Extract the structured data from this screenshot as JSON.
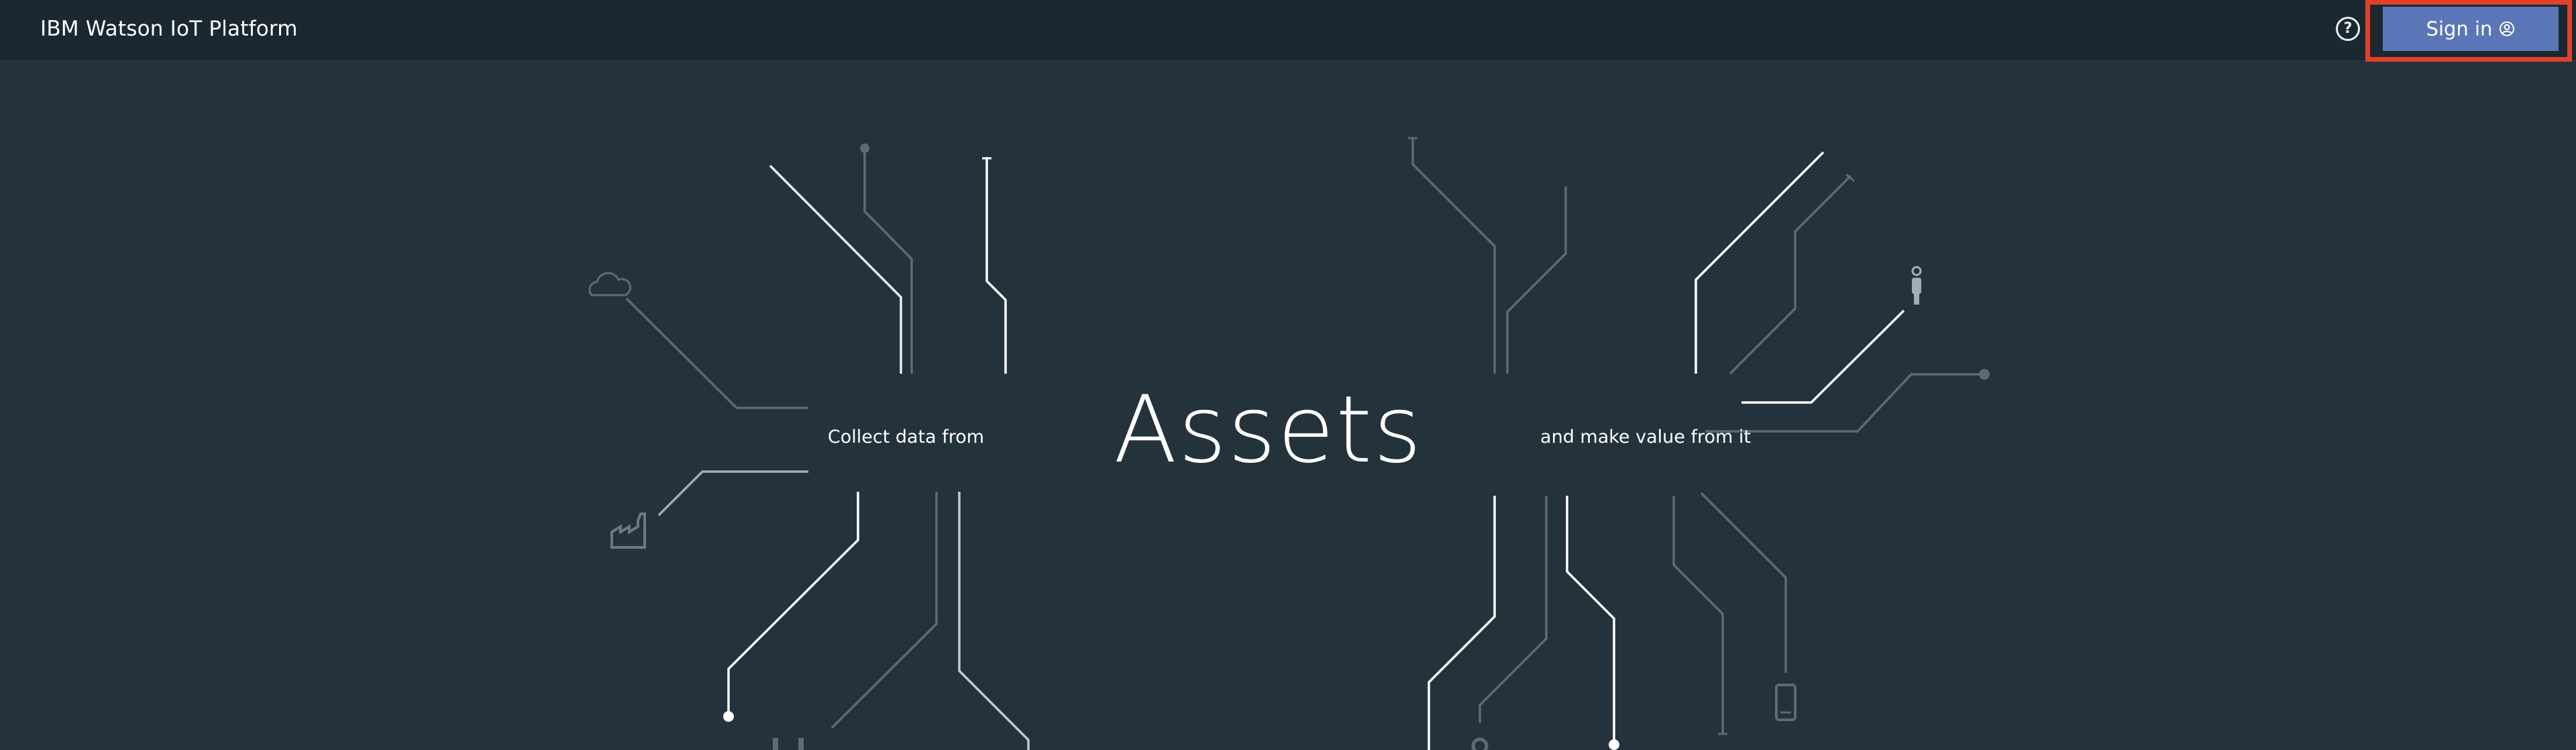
{
  "header": {
    "app_title": "IBM Watson IoT Platform",
    "help_label": "?",
    "signin_label": "Sign in"
  },
  "hero": {
    "left_caption": "Collect data from",
    "title": "Assets",
    "right_caption": "and make value from it"
  },
  "icons": {
    "help": "question-circle-icon",
    "user": "user-circle-icon",
    "cloud": "cloud-icon",
    "factory": "factory-icon",
    "person": "person-icon",
    "mobile": "mobile-phone-icon",
    "gear": "gear-icon",
    "plug": "plug-icon"
  },
  "colors": {
    "background": "#24323c",
    "header": "#1c2831",
    "signin_button": "#5a76b7",
    "highlight_frame": "#e0412a"
  }
}
